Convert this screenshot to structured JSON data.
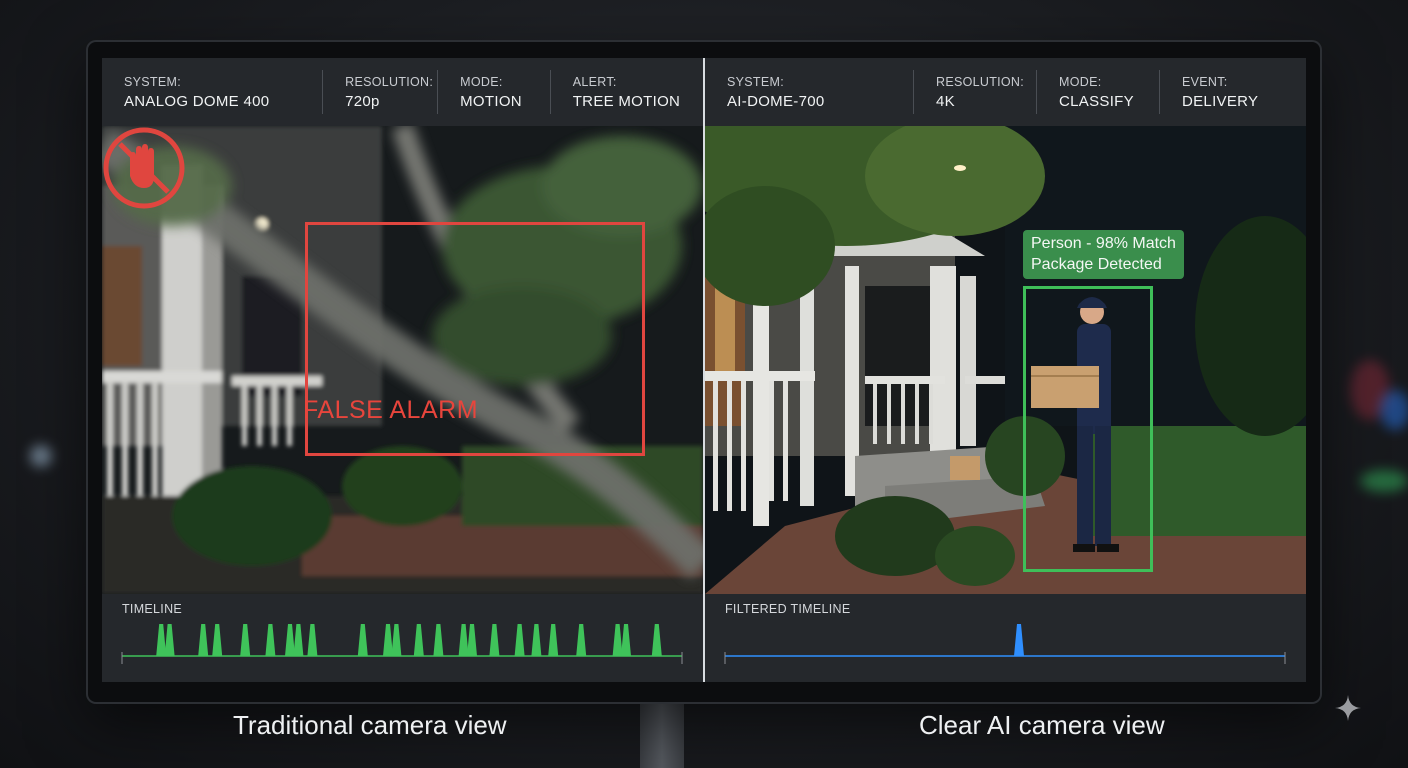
{
  "left_panel": {
    "hud": [
      {
        "label": "SYSTEM:",
        "value": "ANALOG DOME 400"
      },
      {
        "label": "RESOLUTION:",
        "value": "720p"
      },
      {
        "label": "MODE:",
        "value": "MOTION"
      },
      {
        "label": "ALERT:",
        "value": "TREE MOTION"
      }
    ],
    "overlay_text": "FALSE ALARM",
    "overlay_icon": "no-hand-icon",
    "overlay_color": "#e0463f",
    "timeline_label": "TIMELINE",
    "timeline_color": "#3fc35a",
    "timeline_event_count": 24,
    "caption": "Traditional camera view"
  },
  "right_panel": {
    "hud": [
      {
        "label": "SYSTEM:",
        "value": "AI-DOME-700"
      },
      {
        "label": "RESOLUTION:",
        "value": "4K"
      },
      {
        "label": "MODE:",
        "value": "CLASSIFY"
      },
      {
        "label": "EVENT:",
        "value": "DELIVERY"
      }
    ],
    "detection": {
      "line1": "Person - 98% Match",
      "line2": "Package Detected",
      "color": "#3fbf59"
    },
    "timeline_label": "FILTERED TIMELINE",
    "timeline_color": "#2f8fff",
    "timeline_event_count": 1,
    "caption": "Clear AI camera view"
  },
  "decor_icon": "sparkle-icon"
}
